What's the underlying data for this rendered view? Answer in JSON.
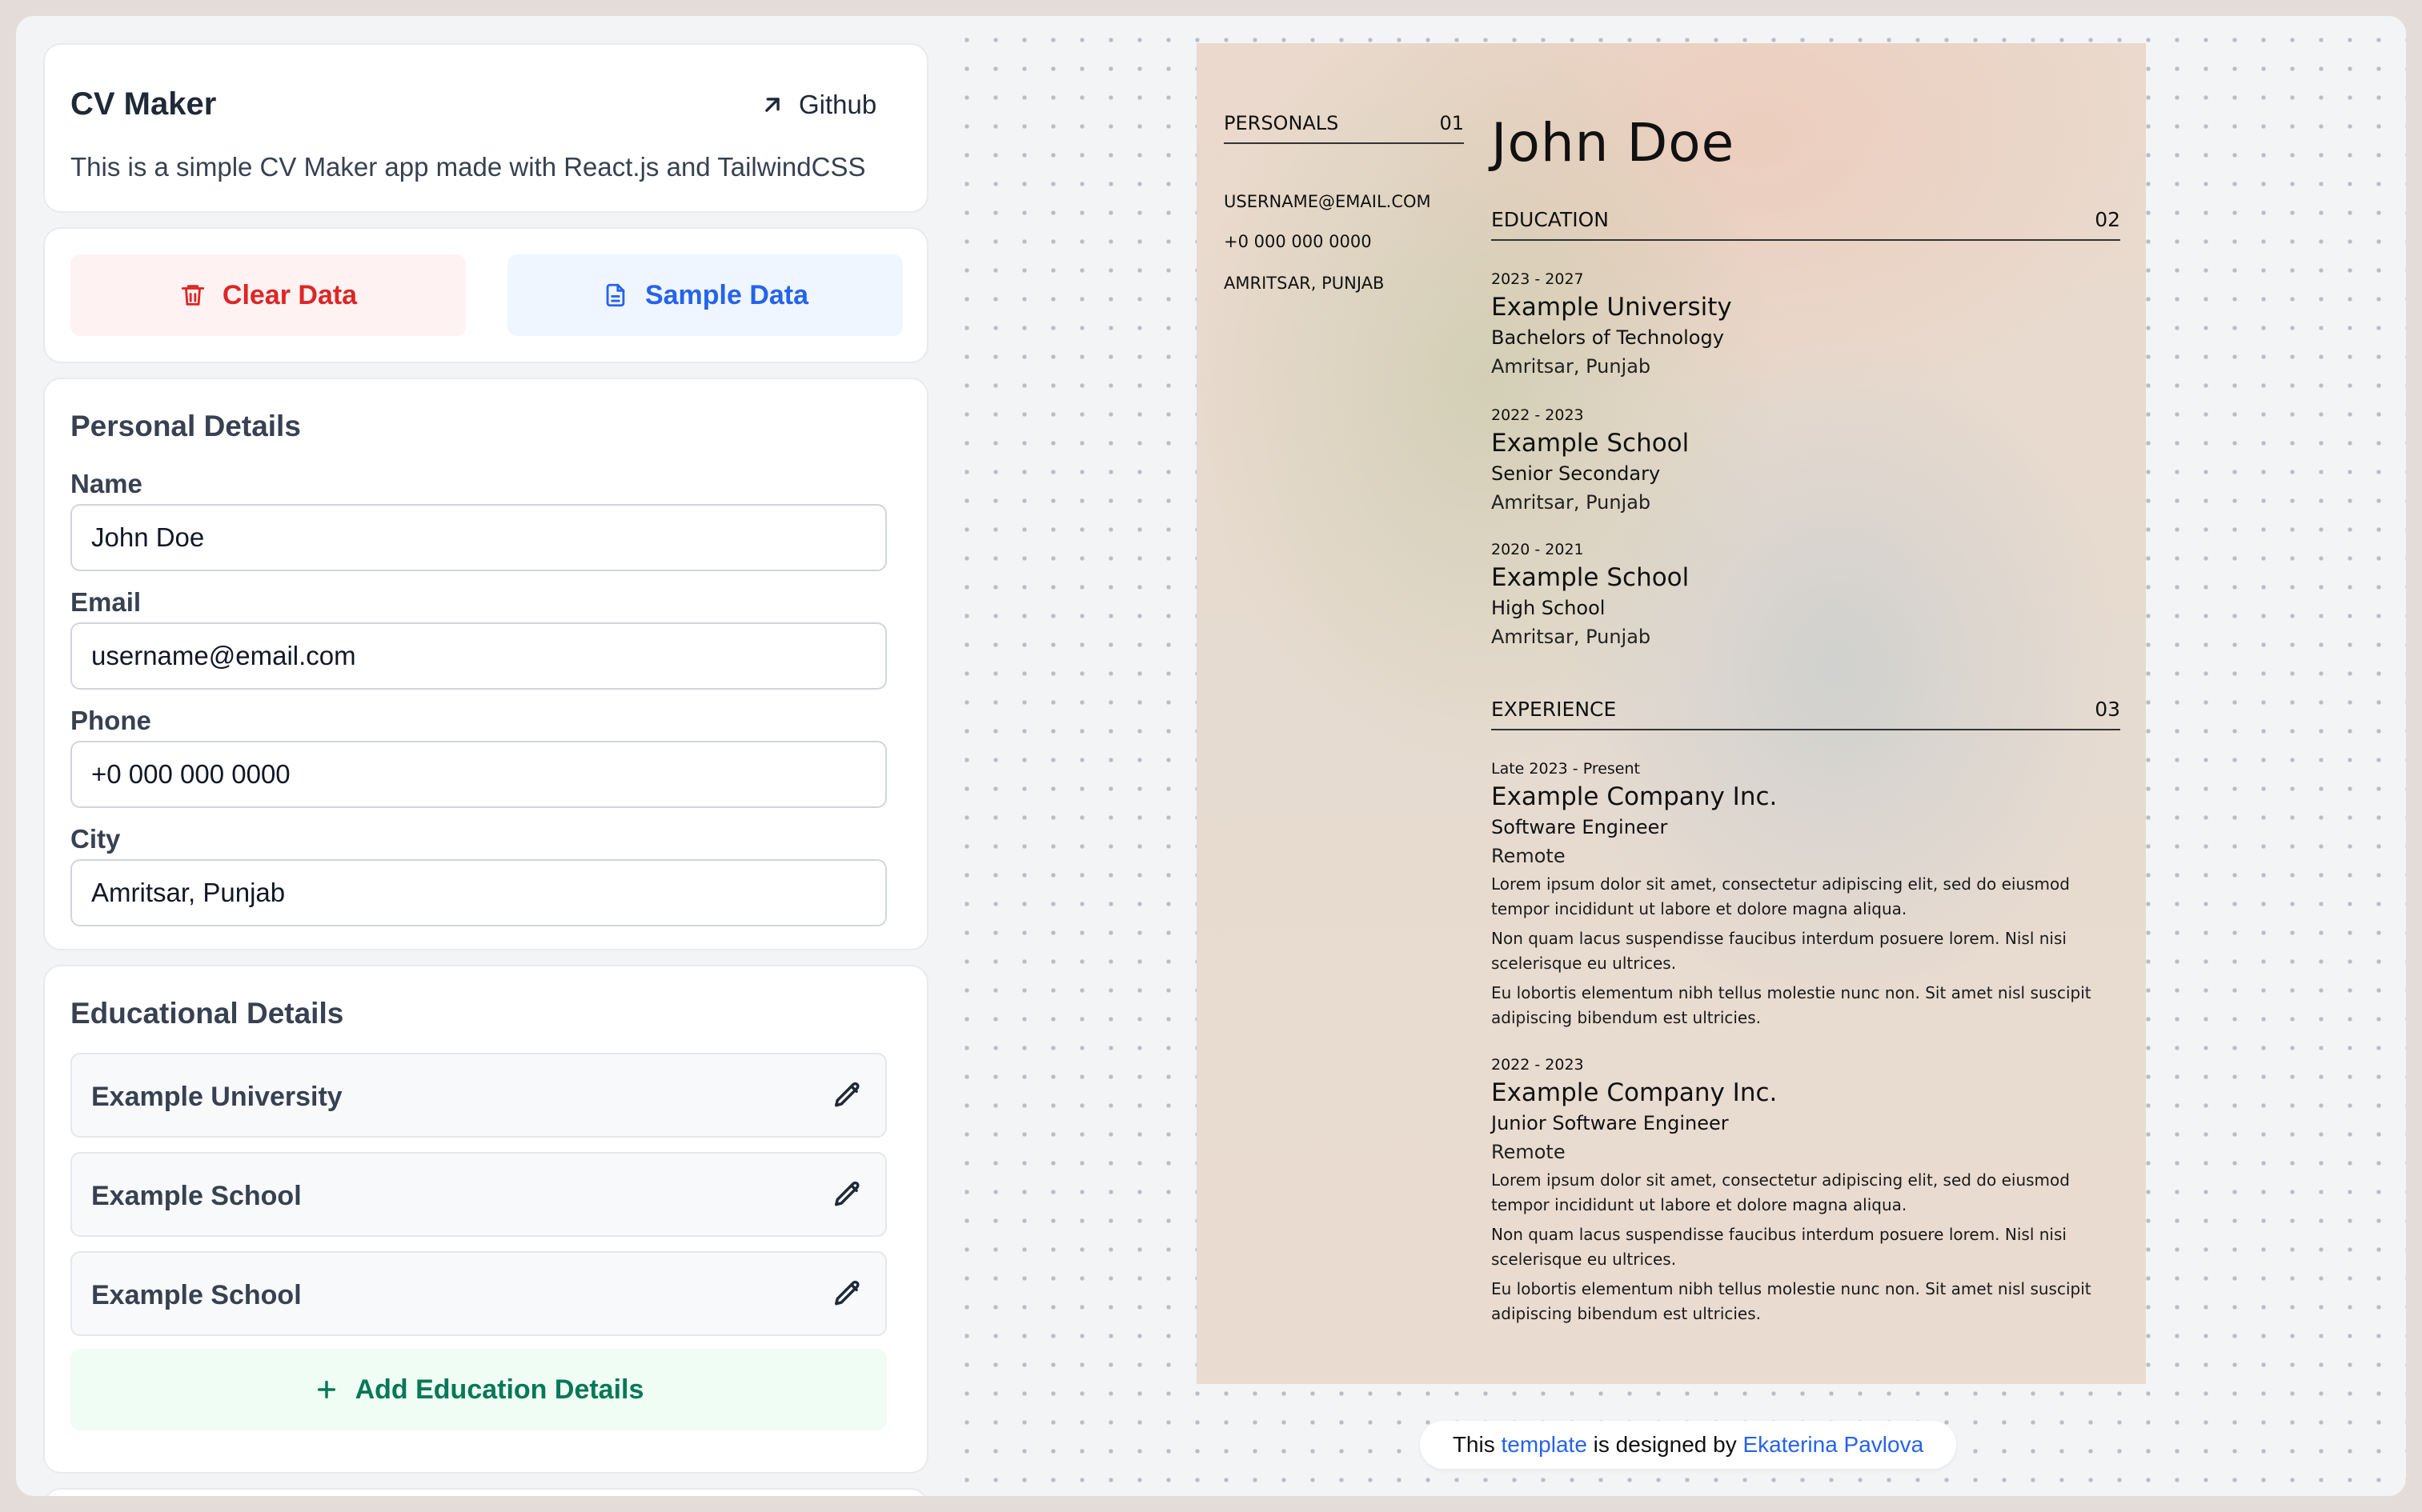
{
  "header": {
    "title": "CV Maker",
    "github_label": "Github",
    "description": "This is a simple CV Maker app made with React.js and TailwindCSS"
  },
  "actions": {
    "clear_label": "Clear Data",
    "sample_label": "Sample Data"
  },
  "personal": {
    "title": "Personal Details",
    "fields": [
      {
        "label": "Name",
        "value": "John Doe"
      },
      {
        "label": "Email",
        "value": "username@email.com"
      },
      {
        "label": "Phone",
        "value": "+0 000 000 0000"
      },
      {
        "label": "City",
        "value": "Amritsar, Punjab"
      }
    ]
  },
  "education_form": {
    "title": "Educational Details",
    "items": [
      {
        "label": "Example University"
      },
      {
        "label": "Example School"
      },
      {
        "label": "Example School"
      }
    ],
    "add_label": "Add Education Details"
  },
  "cv": {
    "personals_heading": "PERSONALS",
    "personals_number": "01",
    "email": "USERNAME@EMAIL.COM",
    "phone": "+0 000 000 0000",
    "city": "AMRITSAR, PUNJAB",
    "name": "John Doe",
    "education_heading": "EDUCATION",
    "education_number": "02",
    "education": [
      {
        "date": "2023 - 2027",
        "org": "Example University",
        "degree": "Bachelors of Technology",
        "location": "Amritsar, Punjab"
      },
      {
        "date": "2022 - 2023",
        "org": "Example School",
        "degree": "Senior Secondary",
        "location": "Amritsar, Punjab"
      },
      {
        "date": "2020 - 2021",
        "org": "Example School",
        "degree": "High School",
        "location": "Amritsar, Punjab"
      }
    ],
    "experience_heading": "EXPERIENCE",
    "experience_number": "03",
    "experience": [
      {
        "date": "Late 2023 - Present",
        "company": "Example Company Inc.",
        "role": "Software Engineer",
        "location": "Remote",
        "points": [
          "Lorem ipsum dolor sit amet, consectetur adipiscing elit, sed do eiusmod tempor incididunt ut labore et dolore magna aliqua.",
          "Non quam lacus suspendisse faucibus interdum posuere lorem. Nisl nisi scelerisque eu ultrices.",
          "Eu lobortis elementum nibh tellus molestie nunc non. Sit amet nisl suscipit adipiscing bibendum est ultricies."
        ]
      },
      {
        "date": "2022 - 2023",
        "company": "Example Company Inc.",
        "role": "Junior Software Engineer",
        "location": "Remote",
        "points": [
          "Lorem ipsum dolor sit amet, consectetur adipiscing elit, sed do eiusmod tempor incididunt ut labore et dolore magna aliqua.",
          "Non quam lacus suspendisse faucibus interdum posuere lorem. Nisl nisi scelerisque eu ultrices.",
          "Eu lobortis elementum nibh tellus molestie nunc non. Sit amet nisl suscipit adipiscing bibendum est ultricies."
        ]
      }
    ]
  },
  "credit": {
    "prefix": "This ",
    "template_link": "template",
    "middle": " is designed by ",
    "author_link": "Ekaterina Pavlova"
  },
  "colors": {
    "danger": "#dc2626",
    "primary": "#2563eb",
    "success": "#047857"
  },
  "icons": {
    "github": "arrow-up-right-icon",
    "clear": "trash-icon",
    "sample": "document-icon",
    "edit": "pencil-icon",
    "add": "plus-icon"
  }
}
